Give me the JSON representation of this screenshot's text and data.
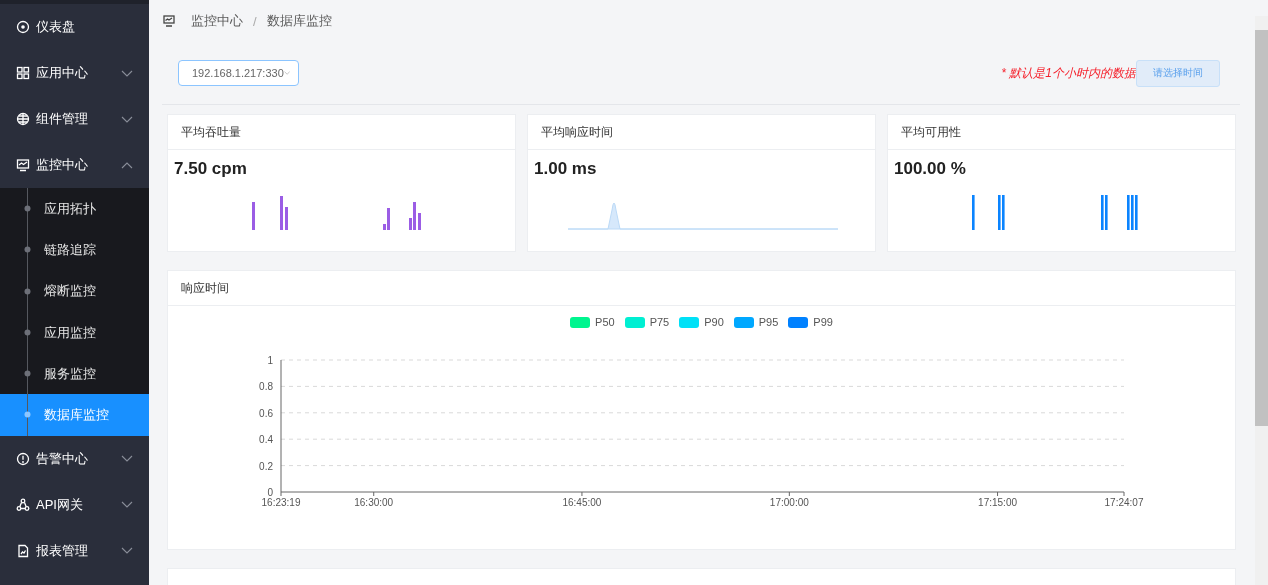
{
  "sidebar": {
    "items": [
      {
        "label": "仪表盘",
        "selected": false
      },
      {
        "label": "应用中心",
        "expanded": false,
        "selected": false
      },
      {
        "label": "组件管理",
        "expanded": false,
        "selected": false
      },
      {
        "label": "监控中心",
        "expanded": true,
        "selected": false,
        "children": [
          {
            "label": "应用拓扑",
            "selected": false
          },
          {
            "label": "链路追踪",
            "selected": false
          },
          {
            "label": "熔断监控",
            "selected": false
          },
          {
            "label": "应用监控",
            "selected": false
          },
          {
            "label": "服务监控",
            "selected": false
          },
          {
            "label": "数据库监控",
            "selected": true
          }
        ]
      },
      {
        "label": "告警中心",
        "expanded": false,
        "selected": false
      },
      {
        "label": "API网关",
        "expanded": false,
        "selected": false
      },
      {
        "label": "报表管理",
        "expanded": false,
        "selected": false
      }
    ]
  },
  "breadcrumb": {
    "items": [
      "监控中心",
      "数据库监控"
    ],
    "separator": "/"
  },
  "toolbar": {
    "instance_select": {
      "value": "192.168.1.217:330"
    },
    "note": "* 默认是1个小时内的数据",
    "time_button": "请选择时间"
  },
  "stat_cards": [
    {
      "title": "平均吞吐量",
      "value": "7.50 cpm",
      "kind": "bars"
    },
    {
      "title": "平均响应时间",
      "value": "1.00 ms",
      "kind": "area"
    },
    {
      "title": "平均可用性",
      "value": "100.00 %",
      "kind": "ticks"
    }
  ],
  "response_time": {
    "title": "响应时间",
    "chart_data": {
      "type": "line",
      "series": [
        {
          "name": "P50",
          "color": "#00f58f",
          "values": [
            null,
            null,
            null,
            null,
            null,
            null
          ]
        },
        {
          "name": "P75",
          "color": "#00efd2",
          "values": [
            null,
            null,
            null,
            null,
            null,
            null
          ]
        },
        {
          "name": "P90",
          "color": "#00e1f7",
          "values": [
            null,
            null,
            null,
            null,
            null,
            null
          ]
        },
        {
          "name": "P95",
          "color": "#00a8ff",
          "values": [
            null,
            null,
            null,
            null,
            null,
            null
          ]
        },
        {
          "name": "P99",
          "color": "#0081ff",
          "values": [
            null,
            null,
            null,
            null,
            null,
            null
          ]
        }
      ],
      "categories": [
        "16:23:19",
        "16:30:00",
        "16:45:00",
        "17:00:00",
        "17:15:00",
        "17:24:07"
      ],
      "ylim": [
        0,
        1
      ],
      "grid": true,
      "yticks": [
        0,
        0.2,
        0.4,
        0.6,
        0.8,
        1
      ]
    }
  }
}
